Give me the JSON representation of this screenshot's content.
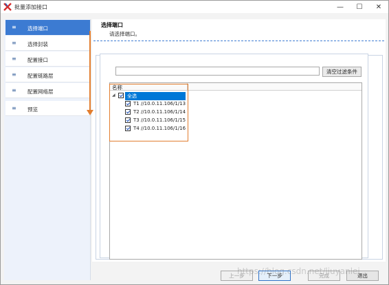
{
  "window": {
    "title": "批量添加接口",
    "controls": {
      "minimize": "—",
      "maximize": "☐",
      "close": "✕"
    }
  },
  "sidebar": {
    "items": [
      {
        "label": "选择端口",
        "active": true
      },
      {
        "label": "选择封装",
        "active": false
      },
      {
        "label": "配置接口",
        "active": false
      },
      {
        "label": "配置链路层",
        "active": false
      },
      {
        "label": "配置网络层",
        "active": false
      },
      {
        "label": "预览",
        "active": false
      }
    ],
    "item_icon": "≡"
  },
  "content": {
    "title": "选择端口",
    "subtitle": "请选择端口。"
  },
  "filter": {
    "placeholder": "",
    "value": "",
    "button_label": "清空过滤条件"
  },
  "tree": {
    "column_header": "名称",
    "root": {
      "label": "全选",
      "checked": true,
      "expanded": true
    },
    "children": [
      {
        "label": "T1 //10.0.11.106/1/13",
        "checked": true
      },
      {
        "label": "T2 //10.0.11.106/1/14",
        "checked": true
      },
      {
        "label": "T3 //10.0.11.106/1/15",
        "checked": true
      },
      {
        "label": "T4 //10.0.11.106/1/16",
        "checked": true
      }
    ]
  },
  "footer": {
    "prev": "上一步",
    "next": "下一步",
    "finish": "完成",
    "exit": "退出"
  },
  "watermark": "https://blog.csdn.net/liuyanlei"
}
